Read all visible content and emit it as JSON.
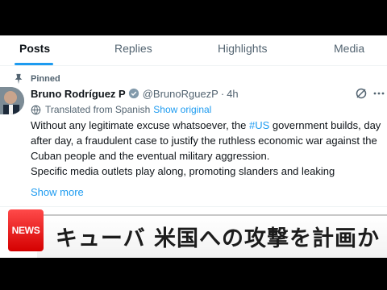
{
  "tabs": [
    {
      "label": "Posts",
      "active": true
    },
    {
      "label": "Replies",
      "active": false
    },
    {
      "label": "Highlights",
      "active": false
    },
    {
      "label": "Media",
      "active": false
    }
  ],
  "pinned_label": "Pinned",
  "post": {
    "author_name": "Bruno Rodríguez P",
    "handle": "@BrunoRguezP",
    "separator": "·",
    "time": "4h",
    "translated_label": "Translated from Spanish",
    "show_original": "Show original",
    "line1_pre": "Without any legitimate excuse whatsoever, the ",
    "hashtag": "#US",
    "line1_post": " government builds, day",
    "line2": "after day, a fraudulent case to justify the ruthless economic war against the",
    "line3": "Cuban people and the eventual military aggression.",
    "line4": "Specific media outlets play along, promoting slanders and leaking",
    "show_more": "Show more"
  },
  "banner": {
    "badge": "NEWS",
    "headline": "キューバ 米国への攻撃を計画か"
  },
  "colors": {
    "accent": "#1d9bf0",
    "text": "#0f1419",
    "muted": "#536471",
    "badge": "#e00000"
  },
  "icons": [
    "pin-icon",
    "verified-icon",
    "grok-icon",
    "more-icon",
    "globe-icon"
  ]
}
